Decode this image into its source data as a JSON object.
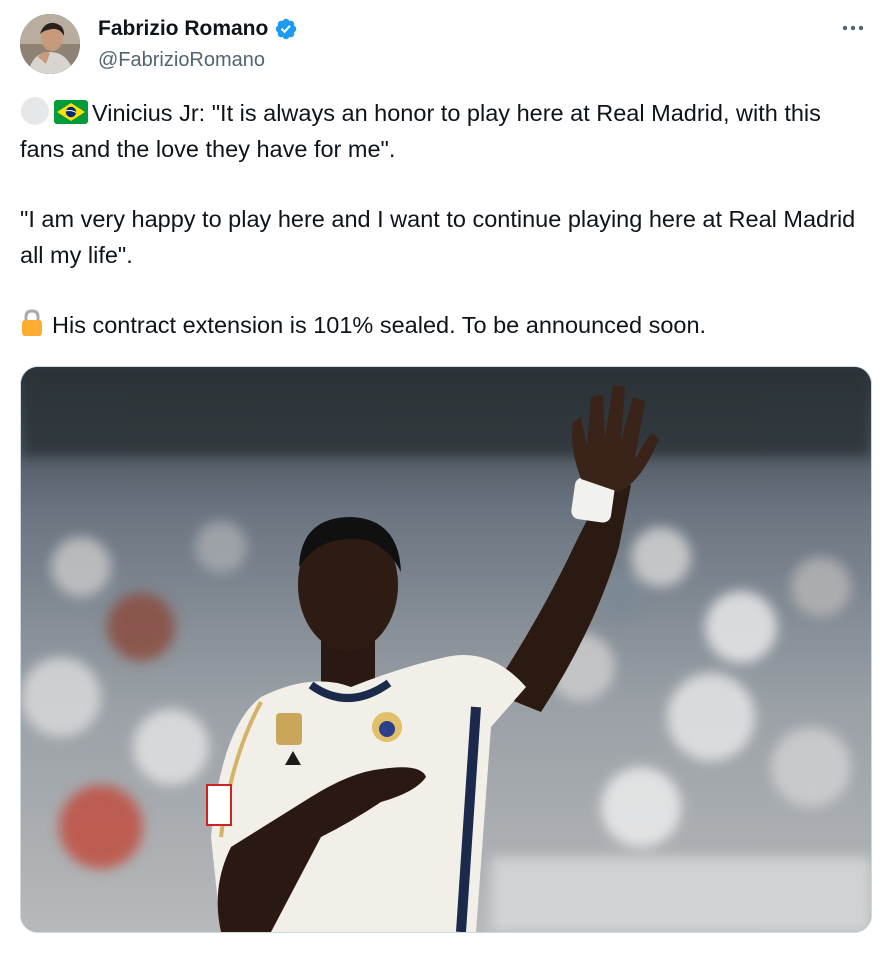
{
  "author": {
    "display_name": "Fabrizio Romano",
    "handle": "@FabrizioRomano",
    "verified": true,
    "avatar_icon": "profile-photo"
  },
  "more_menu_icon": "ellipsis-icon",
  "tweet": {
    "line1_emojis": [
      "white-circle-emoji",
      "brazil-flag-emoji"
    ],
    "paragraph1": "Vinicius Jr: \"It is always an honor to play here at Real Madrid, with this fans and the love they have for me\".",
    "paragraph2": "\"I am very happy to play here and I want to continue playing here at Real Madrid all my life\".",
    "paragraph3_emoji": "lock-emoji",
    "paragraph3": "His contract extension is 101% sealed. To be announced soon."
  },
  "media": {
    "type": "photo",
    "jersey_logos": [
      "adidas-logo",
      "real-madrid-crest",
      "laliga-patch"
    ]
  },
  "colors": {
    "text": "#0f1419",
    "secondary": "#536471",
    "verified_blue": "#1d9bf0",
    "border": "#cfd9de"
  }
}
